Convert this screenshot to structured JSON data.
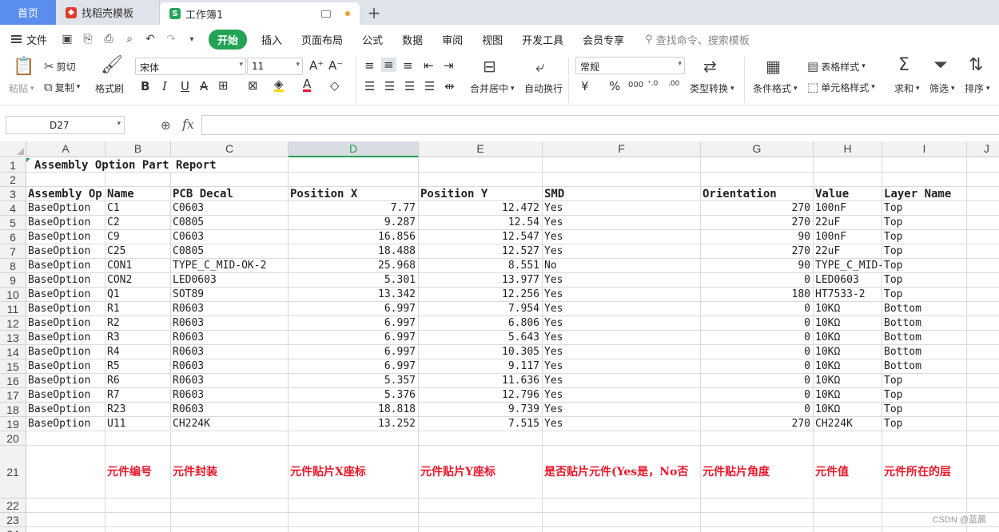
{
  "tabs": {
    "home": "首页",
    "template": "找稻壳模板",
    "workbook": "工作簿1"
  },
  "menu": {
    "file": "文件",
    "items": [
      "开始",
      "插入",
      "页面布局",
      "公式",
      "数据",
      "审阅",
      "视图",
      "开发工具",
      "会员专享"
    ],
    "search": "查找命令、搜索模板"
  },
  "ribbon": {
    "paste": "粘贴",
    "cut": "剪切",
    "copy": "复制",
    "format_painter": "格式刷",
    "font_name": "宋体",
    "font_size": "11",
    "merge_center": "合并居中",
    "wrap_text": "自动换行",
    "number_format": "常规",
    "type_convert": "类型转换",
    "cond_format": "条件格式",
    "table_style": "表格样式",
    "cell_style": "单元格样式",
    "sum": "求和",
    "filter": "筛选",
    "sort": "排序"
  },
  "formula_bar": {
    "name_box": "D27",
    "fx": "fx",
    "content": ""
  },
  "columns": [
    "A",
    "B",
    "C",
    "D",
    "E",
    "F",
    "G",
    "H",
    "I",
    "J"
  ],
  "selected_column": "D",
  "rows": [
    {
      "n": "1",
      "cells": [
        "Assembly Option Part Report",
        "",
        "",
        "",
        "",
        "",
        "",
        "",
        ""
      ]
    },
    {
      "n": "2",
      "cells": [
        "",
        "",
        "",
        "",
        "",
        "",
        "",
        "",
        ""
      ]
    },
    {
      "n": "3",
      "cells": [
        "Assembly Op",
        "Name",
        "PCB Decal",
        "Position X",
        "Position Y",
        "SMD",
        "Orientation",
        "Value",
        "Layer Name"
      ]
    },
    {
      "n": "4",
      "cells": [
        "BaseOption",
        "C1",
        "C0603",
        "7.77",
        "12.472",
        "Yes",
        "270",
        "100nF",
        "Top"
      ]
    },
    {
      "n": "5",
      "cells": [
        "BaseOption",
        "C2",
        "C0805",
        "9.287",
        "12.54",
        "Yes",
        "270",
        "22uF",
        "Top"
      ]
    },
    {
      "n": "6",
      "cells": [
        "BaseOption",
        "C9",
        "C0603",
        "16.856",
        "12.547",
        "Yes",
        "90",
        "100nF",
        "Top"
      ]
    },
    {
      "n": "7",
      "cells": [
        "BaseOption",
        "C25",
        "C0805",
        "18.488",
        "12.527",
        "Yes",
        "270",
        "22uF",
        "Top"
      ]
    },
    {
      "n": "8",
      "cells": [
        "BaseOption",
        "CON1",
        "TYPE_C_MID-OK-2",
        "25.968",
        "8.551",
        "No",
        "90",
        "TYPE_C_MID-",
        "Top"
      ]
    },
    {
      "n": "9",
      "cells": [
        "BaseOption",
        "CON2",
        "LED0603",
        "5.301",
        "13.977",
        "Yes",
        "0",
        "LED0603",
        "Top"
      ]
    },
    {
      "n": "10",
      "cells": [
        "BaseOption",
        "Q1",
        "SOT89",
        "13.342",
        "12.256",
        "Yes",
        "180",
        "HT7533-2",
        "Top"
      ]
    },
    {
      "n": "11",
      "cells": [
        "BaseOption",
        "R1",
        "R0603",
        "6.997",
        "7.954",
        "Yes",
        "0",
        "10KΩ",
        "Bottom"
      ]
    },
    {
      "n": "12",
      "cells": [
        "BaseOption",
        "R2",
        "R0603",
        "6.997",
        "6.806",
        "Yes",
        "0",
        "10KΩ",
        "Bottom"
      ]
    },
    {
      "n": "13",
      "cells": [
        "BaseOption",
        "R3",
        "R0603",
        "6.997",
        "5.643",
        "Yes",
        "0",
        "10KΩ",
        "Bottom"
      ]
    },
    {
      "n": "14",
      "cells": [
        "BaseOption",
        "R4",
        "R0603",
        "6.997",
        "10.305",
        "Yes",
        "0",
        "10KΩ",
        "Bottom"
      ]
    },
    {
      "n": "15",
      "cells": [
        "BaseOption",
        "R5",
        "R0603",
        "6.997",
        "9.117",
        "Yes",
        "0",
        "10KΩ",
        "Bottom"
      ]
    },
    {
      "n": "16",
      "cells": [
        "BaseOption",
        "R6",
        "R0603",
        "5.357",
        "11.636",
        "Yes",
        "0",
        "10KΩ",
        "Top"
      ]
    },
    {
      "n": "17",
      "cells": [
        "BaseOption",
        "R7",
        "R0603",
        "5.376",
        "12.796",
        "Yes",
        "0",
        "10KΩ",
        "Top"
      ]
    },
    {
      "n": "18",
      "cells": [
        "BaseOption",
        "R23",
        "R0603",
        "18.818",
        "9.739",
        "Yes",
        "0",
        "10KΩ",
        "Top"
      ]
    },
    {
      "n": "19",
      "cells": [
        "BaseOption",
        "U11",
        "CH224K",
        "13.252",
        "7.515",
        "Yes",
        "270",
        "CH224K",
        "Top"
      ]
    },
    {
      "n": "20",
      "cells": [
        "",
        "",
        "",
        "",
        "",
        "",
        "",
        "",
        ""
      ]
    },
    {
      "n": "21",
      "cells": [
        "",
        "元件编号",
        "元件封装",
        "元件贴片X座标",
        "元件贴片Y座标",
        "是否贴片元件(Yes是，No否",
        "元件贴片角度",
        "元件值",
        "元件所在的层"
      ]
    },
    {
      "n": "22",
      "cells": [
        "",
        "",
        "",
        "",
        "",
        "",
        "",
        "",
        ""
      ]
    },
    {
      "n": "23",
      "cells": [
        "",
        "",
        "",
        "",
        "",
        "",
        "",
        "",
        ""
      ]
    },
    {
      "n": "24",
      "cells": [
        "",
        "",
        "",
        "",
        "",
        "",
        "",
        "",
        ""
      ]
    }
  ],
  "watermark": "CSDN @蓝晨",
  "colors": {
    "accent": "#22a356",
    "annotation": "#e8192c",
    "home_tab": "#5b8def"
  }
}
